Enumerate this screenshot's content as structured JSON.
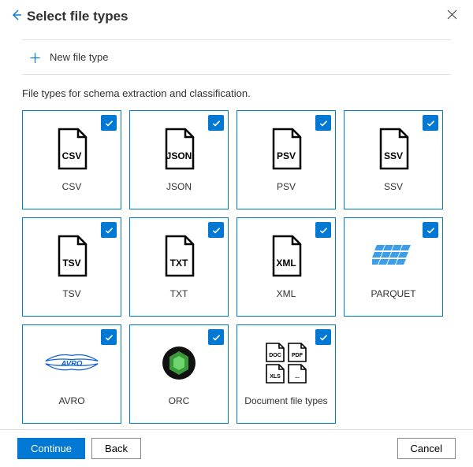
{
  "header": {
    "title": "Select file types"
  },
  "newFileType": {
    "label": "New file type"
  },
  "description": "File types for schema extraction and classification.",
  "tiles": [
    {
      "label": "CSV",
      "iconText": "CSV",
      "type": "file",
      "selected": true
    },
    {
      "label": "JSON",
      "iconText": "JSON",
      "type": "file",
      "selected": true
    },
    {
      "label": "PSV",
      "iconText": "PSV",
      "type": "file",
      "selected": true
    },
    {
      "label": "SSV",
      "iconText": "SSV",
      "type": "file",
      "selected": true
    },
    {
      "label": "TSV",
      "iconText": "TSV",
      "type": "file",
      "selected": true
    },
    {
      "label": "TXT",
      "iconText": "TXT",
      "type": "file",
      "selected": true
    },
    {
      "label": "XML",
      "iconText": "XML",
      "type": "file",
      "selected": true
    },
    {
      "label": "PARQUET",
      "iconText": "",
      "type": "parquet",
      "selected": true
    },
    {
      "label": "AVRO",
      "iconText": "",
      "type": "avro",
      "selected": true
    },
    {
      "label": "ORC",
      "iconText": "",
      "type": "orc",
      "selected": true
    },
    {
      "label": "Document file types",
      "iconText": "",
      "type": "doc",
      "selected": true
    }
  ],
  "docTileLabels": [
    "DOC",
    "PDF",
    "XLS",
    "..."
  ],
  "footer": {
    "continue": "Continue",
    "back": "Back",
    "cancel": "Cancel"
  }
}
